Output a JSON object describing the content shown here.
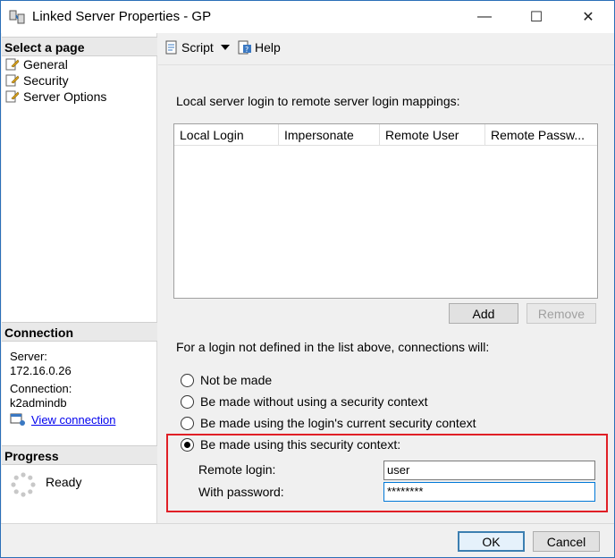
{
  "window": {
    "title": "Linked Server Properties - GP",
    "minimize_glyph": "—",
    "maximize_glyph": "☐",
    "close_glyph": "✕"
  },
  "sidebar": {
    "select_page_header": "Select a page",
    "pages": [
      {
        "label": "General",
        "icon": "page-wrench-icon"
      },
      {
        "label": "Security",
        "icon": "page-wrench-icon"
      },
      {
        "label": "Server Options",
        "icon": "page-wrench-icon"
      }
    ],
    "connection_header": "Connection",
    "server_label": "Server:",
    "server_value": "172.16.0.26",
    "connection_label": "Connection:",
    "connection_value": "k2admindb",
    "view_connection_link": "View connection ",
    "progress_header": "Progress",
    "progress_status": "Ready"
  },
  "toolbar": {
    "script_label": "Script",
    "help_label": "Help"
  },
  "main": {
    "mappings_label": "Local server login to remote server login mappings:",
    "grid_columns": [
      "Local Login",
      "Impersonate",
      "Remote User",
      "Remote Passw..."
    ],
    "grid_rows": [],
    "add_button": "Add",
    "remove_button": "Remove",
    "undefined_login_label": "For a login not defined in the list above, connections will:",
    "options": [
      {
        "label": "Not be made",
        "checked": false
      },
      {
        "label": "Be made without using a security context",
        "checked": false
      },
      {
        "label": "Be made using the login's current security context",
        "checked": false
      },
      {
        "label": "Be made using this security context:",
        "checked": true
      }
    ],
    "remote_login_label": "Remote login:",
    "remote_login_value": "user",
    "password_label": "With password:",
    "password_value": "********",
    "highlight_color": "#e01f26"
  },
  "footer": {
    "ok_button": "OK",
    "cancel_button": "Cancel"
  }
}
